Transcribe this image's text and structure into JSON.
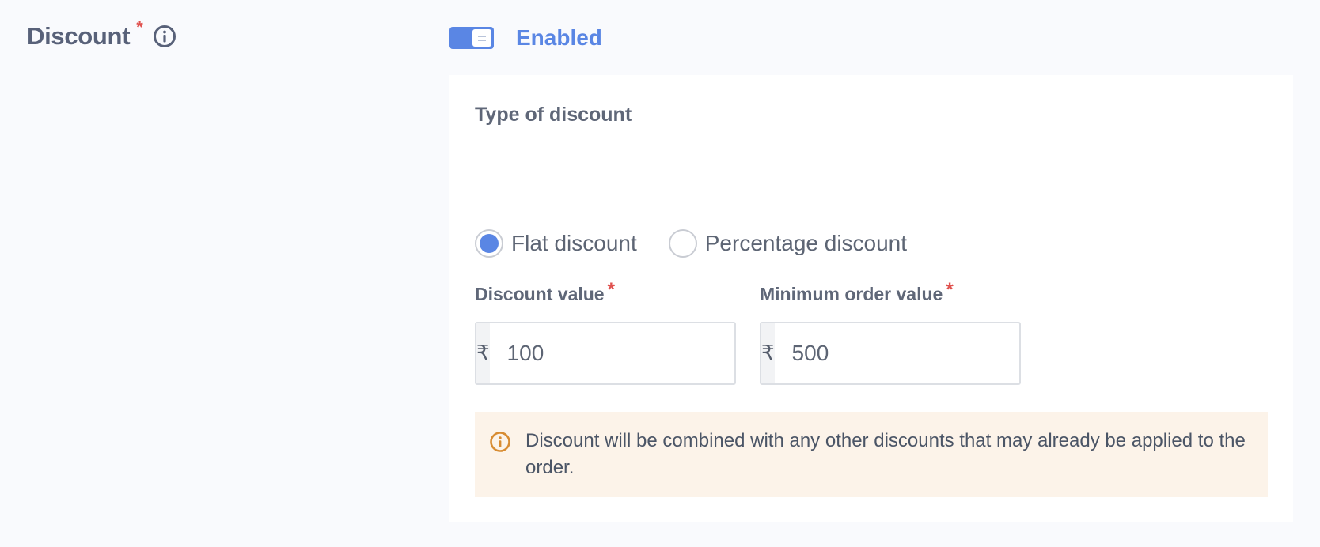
{
  "section": {
    "title": "Discount",
    "required_mark": "*",
    "info_icon": "info-circle-icon"
  },
  "toggle": {
    "state_label": "Enabled",
    "on": true,
    "accent_color": "#5a86e4"
  },
  "discount_type": {
    "title": "Type of discount",
    "options": [
      {
        "label": "Flat discount",
        "selected": true
      },
      {
        "label": "Percentage discount",
        "selected": false
      }
    ]
  },
  "fields": {
    "discount_value": {
      "label": "Discount value",
      "required_mark": "*",
      "currency_symbol": "₹",
      "value": "100"
    },
    "minimum_order_value": {
      "label": "Minimum order value",
      "required_mark": "*",
      "currency_symbol": "₹",
      "value": "500"
    }
  },
  "notice": {
    "icon": "warning-info-icon",
    "text": "Discount will be combined with any other discounts that may already be applied to the order.",
    "background_color": "#fcf3e9",
    "icon_color": "#d88c32"
  }
}
